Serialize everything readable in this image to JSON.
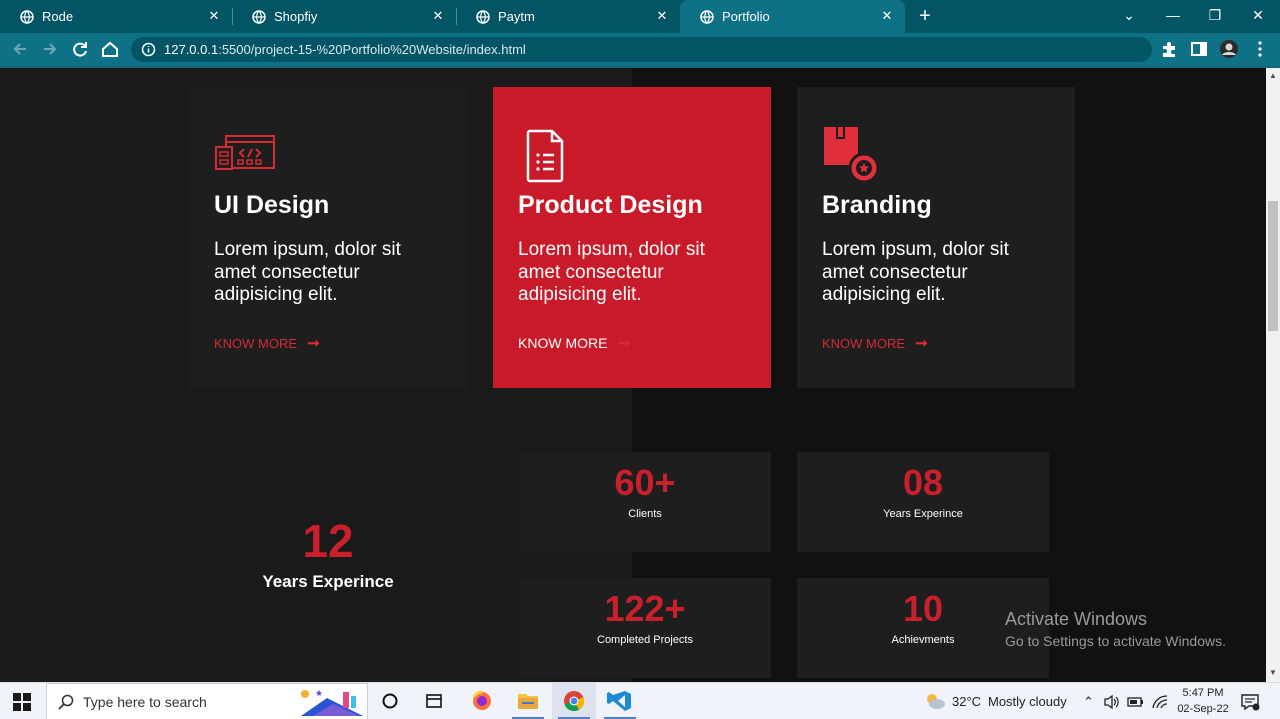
{
  "browser": {
    "tabs": [
      {
        "label": "Rode",
        "active": false
      },
      {
        "label": "Shopfiy",
        "active": false
      },
      {
        "label": "Paytm",
        "active": false
      },
      {
        "label": "Portfolio",
        "active": true
      }
    ],
    "url_host": "127.0.0.1",
    "url_rest": ":5500/project-15-%20Portfolio%20Website/index.html",
    "close_glyph": "✕",
    "new_tab_glyph": "+",
    "controls": {
      "dropdown": "⌄",
      "minimize": "—",
      "restore": "❐",
      "close": "✕"
    }
  },
  "services": [
    {
      "title": "UI Design",
      "desc": "Lorem ipsum, dolor sit amet consectetur adipisicing elit.",
      "link": "KNOW MORE",
      "icon": "web-design-icon",
      "active": false
    },
    {
      "title": "Product Design",
      "desc": "Lorem ipsum, dolor sit amet consectetur adipisicing elit.",
      "link": "KNOW MORE",
      "icon": "document-list-icon",
      "active": true
    },
    {
      "title": "Branding",
      "desc": "Lorem ipsum, dolor sit amet consectetur adipisicing elit.",
      "link": "KNOW MORE",
      "icon": "branding-badge-icon",
      "active": false
    }
  ],
  "arrow_glyph": "➞",
  "experience": {
    "number": "12",
    "label": "Years Experince"
  },
  "stats": [
    {
      "number": "60+",
      "label": "Clients"
    },
    {
      "number": "08",
      "label": "Years Experince"
    },
    {
      "number": "122+",
      "label": "Completed Projects"
    },
    {
      "number": "10",
      "label": "Achievments"
    }
  ],
  "watermark": {
    "line1": "Activate Windows",
    "line2": "Go to Settings to activate Windows."
  },
  "taskbar": {
    "search_placeholder": "Type here to search",
    "weather_temp": "32°C",
    "weather_desc": "Mostly cloudy",
    "time": "5:47 PM",
    "date": "02-Sep-22"
  },
  "colors": {
    "accent": "#c81a29",
    "card_bg": "#1e1e1e",
    "page_bg": "#111111",
    "tabbar": "#035465",
    "toolbar": "#0e7185"
  }
}
